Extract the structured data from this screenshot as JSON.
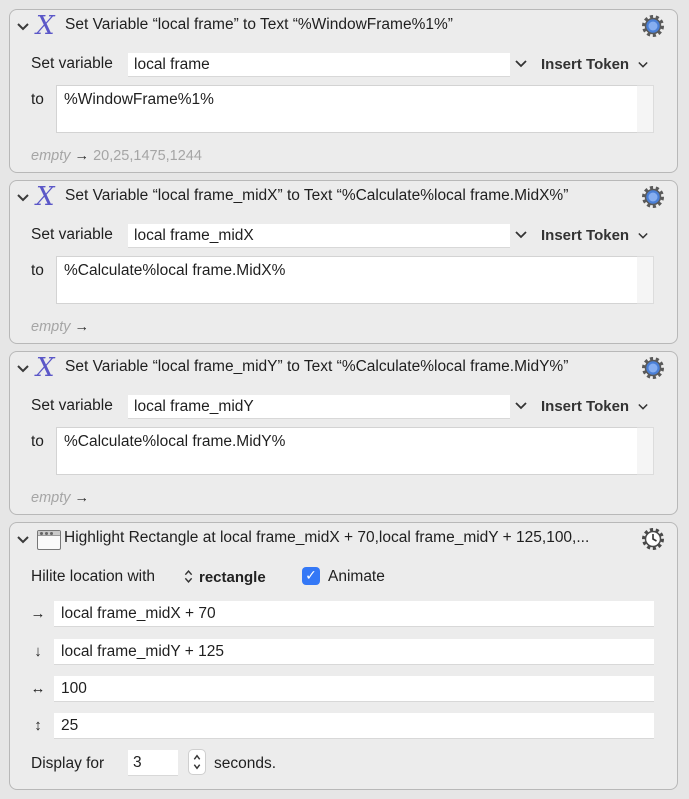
{
  "actions": [
    {
      "title": "Set Variable “local frame” to Text “%WindowFrame%1%”",
      "set_label": "Set variable",
      "variable": "local frame",
      "insert_token": "Insert Token",
      "to_label": "to",
      "text": "%WindowFrame%1%",
      "result_empty": "empty",
      "result_arrow": "→",
      "result_value": "20,25,1475,1244"
    },
    {
      "title": "Set Variable “local frame_midX” to Text “%Calculate%local frame.MidX%”",
      "set_label": "Set variable",
      "variable": "local frame_midX",
      "insert_token": "Insert Token",
      "to_label": "to",
      "text": "%Calculate%local frame.MidX%",
      "result_empty": "empty",
      "result_arrow": "→",
      "result_value": ""
    },
    {
      "title": "Set Variable “local frame_midY” to Text “%Calculate%local frame.MidY%”",
      "set_label": "Set variable",
      "variable": "local frame_midY",
      "insert_token": "Insert Token",
      "to_label": "to",
      "text": "%Calculate%local frame.MidY%",
      "result_empty": "empty",
      "result_arrow": "→",
      "result_value": ""
    }
  ],
  "highlight": {
    "title": "Highlight Rectangle at local frame_midX + 70,local frame_midY + 125,100,...",
    "hilite_label": "Hilite location with",
    "hilite_value": "rectangle",
    "animate_label": "Animate",
    "animate_checked": true,
    "rows": [
      {
        "icon": "→",
        "value": "local frame_midX + 70"
      },
      {
        "icon": "↓",
        "value": "local frame_midY + 125"
      },
      {
        "icon": "↔",
        "value": "100"
      },
      {
        "icon": "↕",
        "value": "25"
      }
    ],
    "display_label": "Display for",
    "display_value": "3",
    "display_unit": "seconds."
  },
  "icons": {
    "set_variable": "variable-x-icon",
    "highlight": "window-icon",
    "gear": "gear-icon",
    "timer_gear": "gear-clock-icon",
    "disclosure": "chevron-down-icon",
    "popup": "chevron-updown-icon",
    "check": "✓",
    "x_glyph": "X"
  },
  "colors": {
    "action_icon": "#5b57c8",
    "gear_blue": "#4a7fd6",
    "checkbox": "#3478f6"
  }
}
